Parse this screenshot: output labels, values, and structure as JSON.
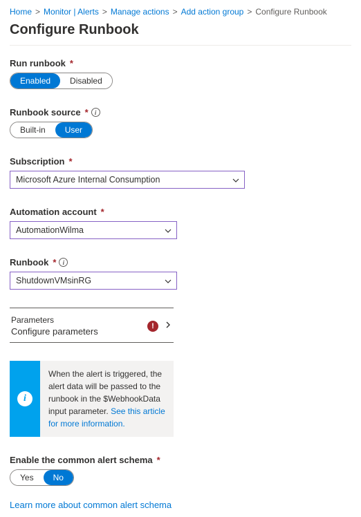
{
  "breadcrumb": {
    "items": [
      {
        "label": "Home"
      },
      {
        "label": "Monitor | Alerts"
      },
      {
        "label": "Manage actions"
      },
      {
        "label": "Add action group"
      }
    ],
    "current": "Configure Runbook"
  },
  "page_title": "Configure Runbook",
  "run_runbook": {
    "label": "Run runbook",
    "options": {
      "enabled": "Enabled",
      "disabled": "Disabled"
    },
    "selected": "enabled"
  },
  "runbook_source": {
    "label": "Runbook source",
    "options": {
      "builtin": "Built-in",
      "user": "User"
    },
    "selected": "user"
  },
  "subscription": {
    "label": "Subscription",
    "value": "Microsoft Azure Internal Consumption"
  },
  "automation_account": {
    "label": "Automation account",
    "value": "AutomationWilma"
  },
  "runbook": {
    "label": "Runbook",
    "value": "ShutdownVMsinRG"
  },
  "parameters": {
    "label": "Parameters",
    "sublabel": "Configure parameters",
    "error_glyph": "!"
  },
  "info_banner": {
    "text_before": "When the alert is triggered, the alert data will be passed to the runbook in the $WebhookData input parameter. ",
    "link_text": "See this article for more information."
  },
  "common_schema": {
    "label": "Enable the common alert schema",
    "options": {
      "yes": "Yes",
      "no": "No"
    },
    "selected": "no"
  },
  "learn_more_link": "Learn more about common alert schema",
  "glyphs": {
    "required": "*",
    "info": "i"
  }
}
